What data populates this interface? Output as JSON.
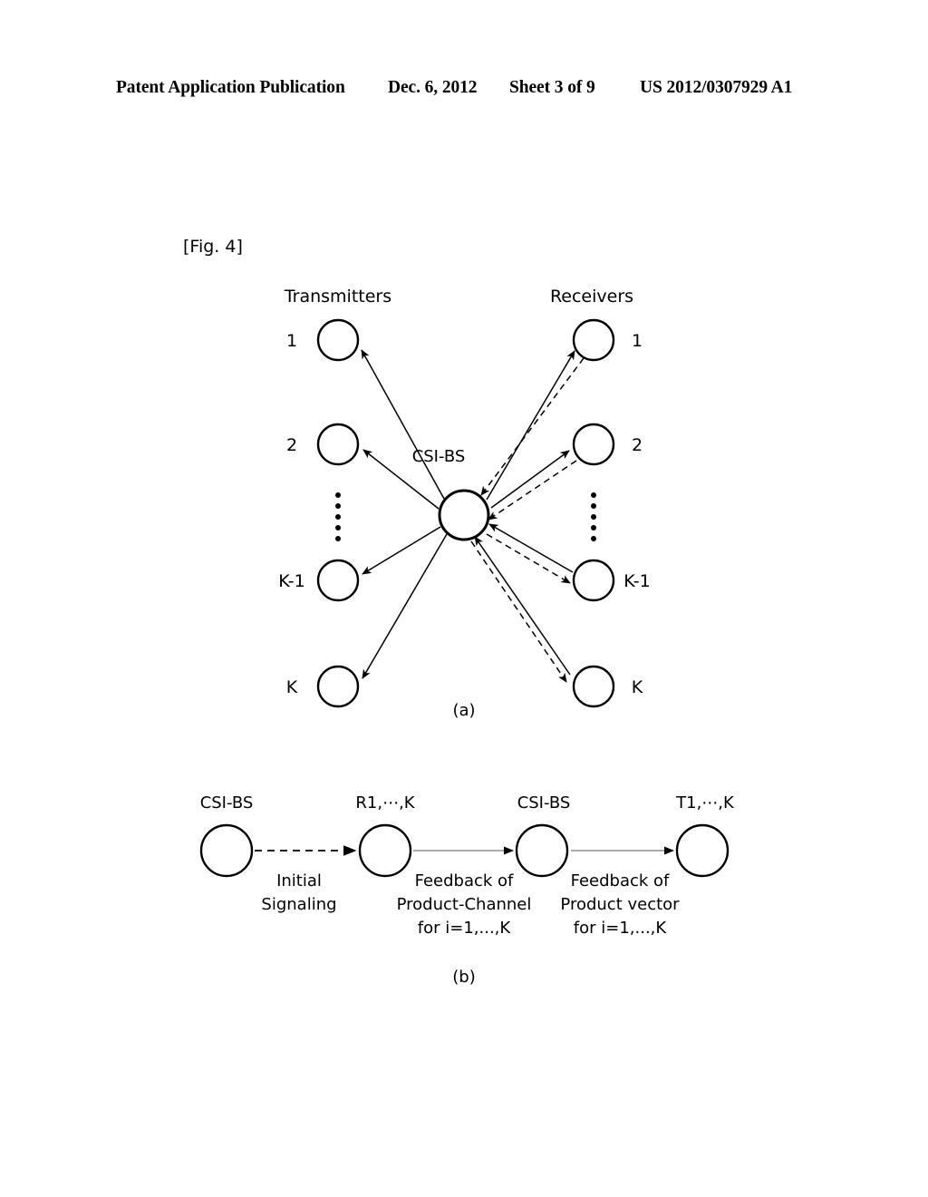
{
  "header": {
    "publication": "Patent Application Publication",
    "date": "Dec. 6, 2012",
    "sheet": "Sheet 3 of 9",
    "number": "US 2012/0307929 A1"
  },
  "figure": {
    "label": "[Fig. 4]",
    "part_a_label": "(a)",
    "part_b_label": "(b)"
  },
  "panel_a": {
    "left_heading": "Transmitters",
    "right_heading": "Receivers",
    "hub_label": "CSI-BS",
    "transmitter_labels": [
      "1",
      "2",
      "K-1",
      "K"
    ],
    "receiver_labels": [
      "1",
      "2",
      "K-1",
      "K"
    ],
    "ellipsis_dot_count": 5
  },
  "panel_b": {
    "nodes": [
      {
        "title": "CSI-BS"
      },
      {
        "title": "R1,⋯,K"
      },
      {
        "title": "CSI-BS"
      },
      {
        "title": "T1,⋯,K"
      }
    ],
    "edges": [
      {
        "style": "dashed",
        "caption_lines": [
          "Initial",
          "Signaling"
        ]
      },
      {
        "style": "solid-thin",
        "caption_lines": [
          "Feedback of",
          "Product-Channel",
          "for i=1,...,K"
        ]
      },
      {
        "style": "solid-thin",
        "caption_lines": [
          "Feedback of",
          "Product vector",
          "for i=1,...,K"
        ]
      }
    ]
  },
  "colors": {
    "ink": "#000000",
    "paper": "#ffffff",
    "thin_line": "#8e8e8e"
  }
}
